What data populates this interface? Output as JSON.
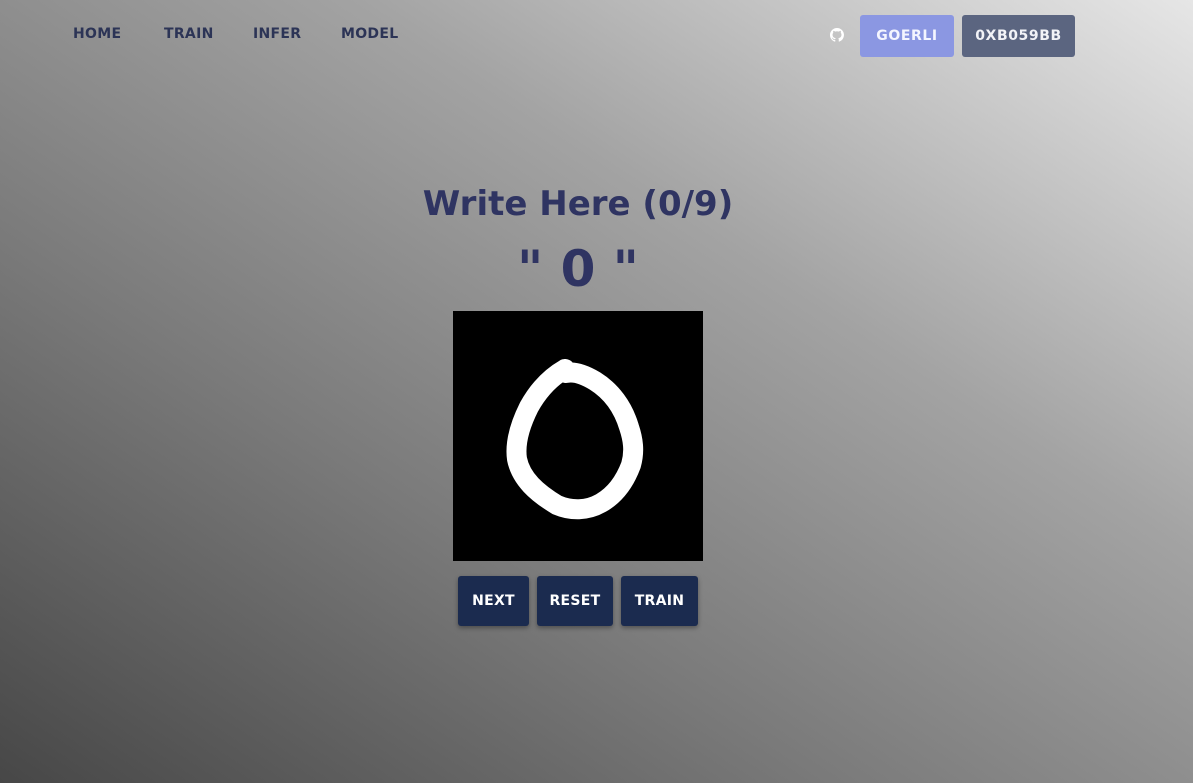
{
  "nav": {
    "items": [
      {
        "label": "HOME"
      },
      {
        "label": "TRAIN"
      },
      {
        "label": "INFER"
      },
      {
        "label": "MODEL"
      }
    ],
    "github_icon": "github-icon",
    "network_label": "GOERLI",
    "account_label": "0XB059BB"
  },
  "colors": {
    "nav_text": "#2c3456",
    "network_button": "#8b97e2",
    "account_button": "#5b6580",
    "heading": "#2f3462",
    "action_button": "#1b2b4f",
    "canvas_background": "#000000",
    "stroke": "#ffffff"
  },
  "main": {
    "heading": "Write Here (0/9)",
    "digit_prompt": "\" 0 \"",
    "canvas_icon": "drawing-canvas"
  },
  "actions": {
    "next_label": "NEXT",
    "reset_label": "RESET",
    "train_label": "TRAIN"
  }
}
